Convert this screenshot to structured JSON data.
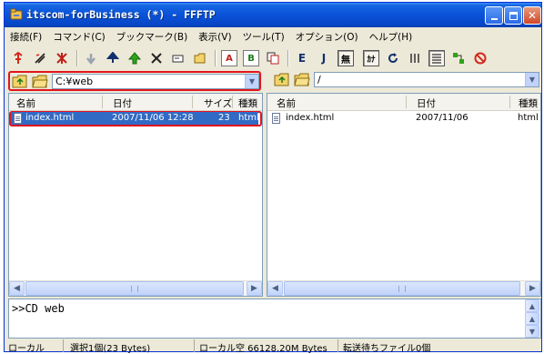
{
  "window": {
    "title": "itscom-forBusiness (*) - FFFTP"
  },
  "menubar": [
    "接続(F)",
    "コマンド(C)",
    "ブックマーク(B)",
    "表示(V)",
    "ツール(T)",
    "オプション(O)",
    "ヘルプ(H)"
  ],
  "toolbar": {
    "text_buttons": {
      "ascii": "A",
      "binary": "B",
      "euc": "E",
      "jis": "J",
      "no_conv": "無",
      "kana": "ｶﾅ"
    }
  },
  "local": {
    "path": "C:¥web",
    "columns": [
      "名前",
      "日付",
      "サイズ",
      "種類"
    ],
    "files": [
      {
        "name": "index.html",
        "date": "2007/11/06 12:28",
        "size": "23",
        "type": "html",
        "selected": true
      }
    ]
  },
  "remote": {
    "path": "/",
    "columns": [
      "名前",
      "日付",
      "種類"
    ],
    "files": [
      {
        "name": "index.html",
        "date": "2007/11/06",
        "type": "html"
      }
    ]
  },
  "log": {
    "text": ">>CD web"
  },
  "status": {
    "mode": "ローカル",
    "selection": "選択1個(23 Bytes)",
    "free_space": "ローカル空 66128.20M Bytes",
    "queue": "転送待ちファイル0個"
  },
  "colors": {
    "titlebar": "#0a52d8",
    "selection": "#316ac5",
    "highlight": "#e3141c",
    "chrome": "#ece9d8"
  }
}
